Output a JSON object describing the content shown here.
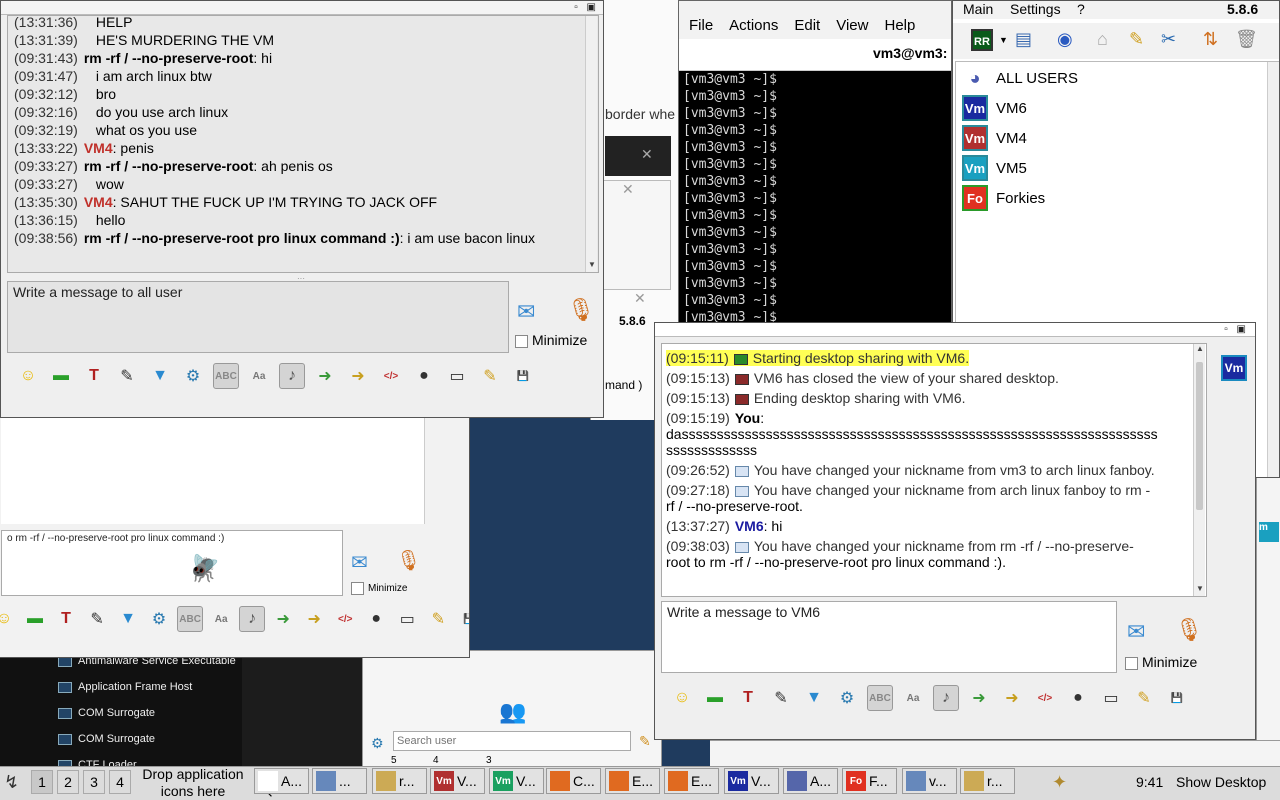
{
  "colors": {
    "desktop": "#1f3b5e",
    "terminal_bg": "#000000",
    "terminal_fg": "#d8d8d8",
    "highlight": "#ffff55",
    "nick_red": "#c0302a",
    "nick_blue": "#1a1aa0",
    "vm_blue": "#1a2aa0",
    "vm_red": "#b03030",
    "vm_cyan": "#1aa0c0",
    "fo_red": "#e03020"
  },
  "chat_all": {
    "messages": [
      {
        "ts": "(13:31:36)",
        "nick": "",
        "text": "HELP",
        "style": "plain"
      },
      {
        "ts": "(13:31:39)",
        "nick": "",
        "text": "HE'S MURDERING THE VM",
        "style": "plain"
      },
      {
        "ts": "(09:31:43)",
        "nick": "rm -rf / --no-preserve-root",
        "text": ": hi",
        "style": "bold"
      },
      {
        "ts": "(09:31:47)",
        "nick": "",
        "text": "i am arch linux btw",
        "style": "plain"
      },
      {
        "ts": "(09:32:12)",
        "nick": "",
        "text": "bro",
        "style": "plain"
      },
      {
        "ts": "(09:32:16)",
        "nick": "",
        "text": "do you use arch linux",
        "style": "plain"
      },
      {
        "ts": "(09:32:19)",
        "nick": "",
        "text": "what os you use",
        "style": "plain"
      },
      {
        "ts": "(13:33:22)",
        "nick": "VM4",
        "text": ": penis",
        "style": "red"
      },
      {
        "ts": "(09:33:27)",
        "nick": "rm -rf / --no-preserve-root",
        "text": ": ah penis os",
        "style": "bold"
      },
      {
        "ts": "(09:33:27)",
        "nick": "",
        "text": "wow",
        "style": "plain"
      },
      {
        "ts": "(13:35:30)",
        "nick": "VM4",
        "text": ": SAHUT THE FUCK UP I'M TRYING TO JACK OFF",
        "style": "red"
      },
      {
        "ts": "(13:36:15)",
        "nick": "",
        "text": "hello",
        "style": "plain"
      },
      {
        "ts": "(09:38:56)",
        "nick": "rm -rf / --no-preserve-root pro linux command :)",
        "text": ": i am use bacon linux",
        "style": "bold"
      }
    ],
    "placeholder": "Write a message to all user",
    "minimize_label": "Minimize"
  },
  "behind_window": {
    "compose_text": "o rm -rf / --no-preserve-root pro linux command :)",
    "minimize_label": "Minimize",
    "fragment_border": "border whe",
    "fragment_version": "5.8.6",
    "fragment_command": "mand )"
  },
  "process_list": {
    "items": [
      "Antimalware Service Executable",
      "Application Frame Host",
      "COM Surrogate",
      "COM Surrogate",
      "CTF Loader"
    ]
  },
  "search": {
    "placeholder": "Search user",
    "tab_counts": [
      "5",
      "4",
      "3"
    ]
  },
  "terminal": {
    "menu": [
      "File",
      "Actions",
      "Edit",
      "View",
      "Help"
    ],
    "title": "vm3@vm3:",
    "prompt": "[vm3@vm3 ~]$",
    "line_count": 15
  },
  "users_panel": {
    "menu": [
      "Main",
      "Settings",
      "?"
    ],
    "version": "5.8.6",
    "rr_badge": "RR",
    "users": [
      {
        "name": "ALL USERS",
        "avatar": "all-users"
      },
      {
        "name": "VM6",
        "avatar": "Vm",
        "color": "#1a2aa0"
      },
      {
        "name": "VM4",
        "avatar": "Vm",
        "color": "#b03030"
      },
      {
        "name": "VM5",
        "avatar": "Vm",
        "color": "#1aa0c0"
      },
      {
        "name": "Forkies",
        "avatar": "Fo",
        "color": "#e03020"
      }
    ]
  },
  "chat_vm6": {
    "side_avatar": "Vm",
    "messages": [
      {
        "ts": "(09:15:11)",
        "text": "Starting desktop sharing with VM6.",
        "kind": "share-start"
      },
      {
        "ts": "(09:15:13)",
        "text": "VM6 has closed the view of your shared desktop.",
        "kind": "share-closed"
      },
      {
        "ts": "(09:15:13)",
        "text": "Ending desktop sharing with VM6.",
        "kind": "share-end"
      },
      {
        "ts": "(09:15:19)",
        "nick": "You",
        "text": ":",
        "kind": "you"
      },
      {
        "ts": "",
        "text": "dassssssssssssssssssssssssssssssssssssssssssssssssssssssssssssssssssss",
        "kind": "cont"
      },
      {
        "ts": "",
        "text": "sssssssssssss",
        "kind": "cont"
      },
      {
        "ts": "(09:26:52)",
        "text": "You have changed your nickname from vm3 to arch linux fanboy.",
        "kind": "info"
      },
      {
        "ts": "(09:27:18)",
        "text": "You have changed your nickname from arch linux fanboy to rm -",
        "kind": "info"
      },
      {
        "ts": "",
        "text": "rf / --no-preserve-root.",
        "kind": "cont"
      },
      {
        "ts": "(13:37:27)",
        "nick": "VM6",
        "text": ": hi",
        "kind": "vm6"
      },
      {
        "ts": "(09:38:03)",
        "text": "You have changed your nickname from rm -rf / --no-preserve-",
        "kind": "info"
      },
      {
        "ts": "",
        "text": "root to rm -rf / --no-preserve-root pro linux command :).",
        "kind": "cont"
      }
    ],
    "placeholder": "Write a message to VM6",
    "minimize_label": "Minimize"
  },
  "taskbar": {
    "pager": [
      "1",
      "2",
      "3",
      "4"
    ],
    "drop_text_1": "Drop application",
    "drop_text_2": "icons here",
    "tasks": [
      {
        "label": "A...",
        "icon": "mouse-icon",
        "color": "#ffffff"
      },
      {
        "label": "...",
        "icon": "window-icon",
        "color": "#6688bb"
      },
      {
        "label": "r...",
        "icon": "chat-icon",
        "color": "#ccaa55"
      },
      {
        "label": "V...",
        "icon": "Vm",
        "color": "#b03030"
      },
      {
        "label": "V...",
        "icon": "Vm",
        "color": "#1aa060"
      },
      {
        "label": "C...",
        "icon": "firefox-icon",
        "color": "#e06a20"
      },
      {
        "label": "E...",
        "icon": "firefox-icon",
        "color": "#e06a20"
      },
      {
        "label": "E...",
        "icon": "firefox-icon",
        "color": "#e06a20"
      },
      {
        "label": "V...",
        "icon": "Vm",
        "color": "#1a2aa0"
      },
      {
        "label": "A...",
        "icon": "users-icon",
        "color": "#5566aa"
      },
      {
        "label": "F...",
        "icon": "Fo",
        "color": "#e03020"
      },
      {
        "label": "v...",
        "icon": "window-icon",
        "color": "#6688bb"
      },
      {
        "label": "r...",
        "icon": "chat-icon",
        "color": "#ccaa55"
      }
    ],
    "clock": "9:41",
    "show_desktop": "Show Desktop"
  }
}
